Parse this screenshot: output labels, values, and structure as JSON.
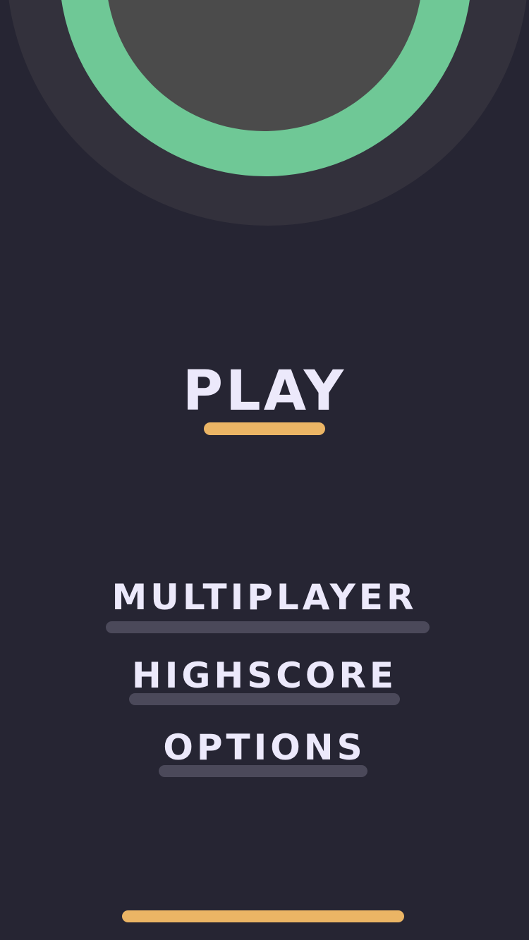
{
  "menu": {
    "play_label": "PLAY",
    "multiplayer_label": "MULTIPLAYER",
    "highscore_label": "HIGHSCORE",
    "options_label": "OPTIONS"
  },
  "colors": {
    "background": "#262533",
    "ring_outer": "#33313c",
    "ring_green": "#6fc896",
    "ring_inner": "#4b4b4b",
    "accent": "#ebb565",
    "muted_bar": "#4b495a",
    "text": "#ece9fb"
  }
}
